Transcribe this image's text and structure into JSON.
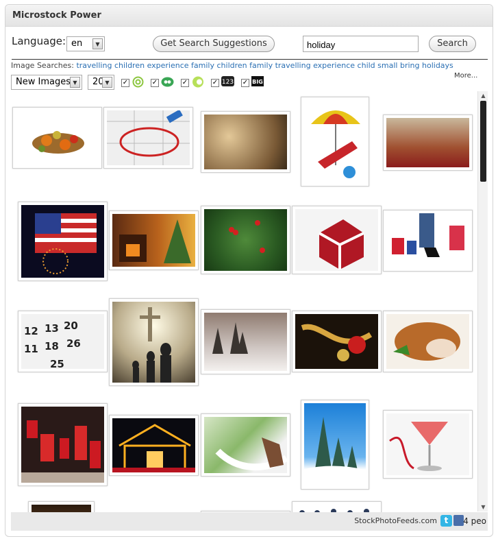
{
  "widget": {
    "title": "Microstock Power"
  },
  "controls": {
    "language_label": "Language:",
    "language_value": "en",
    "suggest_button": "Get Search Suggestions",
    "search_value": "holiday",
    "search_button": "Search"
  },
  "image_searches": {
    "label": "Image Searches:",
    "terms": [
      "travelling",
      "children",
      "experience",
      "family",
      "children",
      "family",
      "travelling",
      "experience",
      "child",
      "small",
      "bring",
      "holidays"
    ],
    "more": "More..."
  },
  "filters": {
    "sort_value": "New Images",
    "count_value": "20",
    "agencies": [
      {
        "icon": "swirl-agency-icon",
        "checked": true
      },
      {
        "icon": "dreamstime-agency-icon",
        "checked": true
      },
      {
        "icon": "fotolia-agency-icon",
        "checked": true
      },
      {
        "icon": "123rf-agency-icon",
        "checked": true,
        "label": "123"
      },
      {
        "icon": "bigstock-agency-icon",
        "checked": true,
        "label": "BIG"
      }
    ]
  },
  "images": [
    "cornucopia-thumbnail",
    "holiday-calendar-thumbnail",
    "bokeh-lights-thumbnail",
    "beach-chair-umbrella-thumbnail",
    "family-dinner-thumbnail",
    "flag-fireworks-thumbnail",
    "fireplace-tree-thumbnail",
    "holly-branch-thumbnail",
    "gift-box-thumbnail",
    "shopping-bags-thumbnail",
    "calendar-dates-thumbnail",
    "cross-silhouette-thumbnail",
    "snowy-trees-thumbnail",
    "ornament-ribbon-thumbnail",
    "roast-turkey-thumbnail",
    "store-window-thumbnail",
    "lit-house-thumbnail",
    "hammock-feet-thumbnail",
    "snow-pines-thumbnail",
    "cocktail-glass-thumbnail",
    "dark-scene-thumbnail",
    "white-scene-thumbnail",
    "silhouettes-thumbnail"
  ],
  "footer": {
    "link": "StockPhotoFeeds.com",
    "like_count": "4 peo"
  }
}
